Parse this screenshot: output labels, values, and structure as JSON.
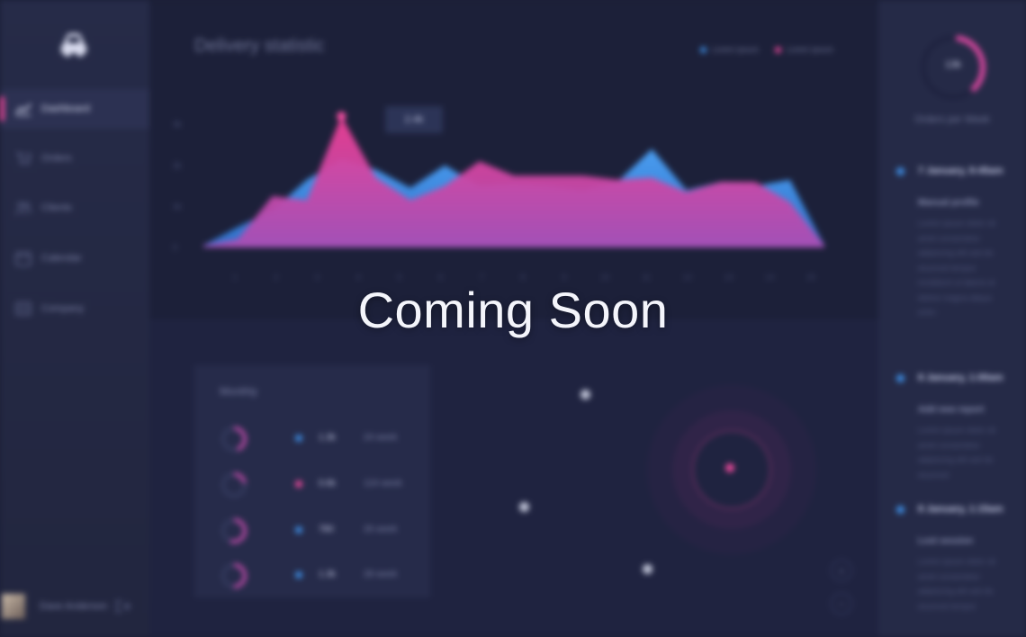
{
  "overlay": {
    "text": "Coming Soon"
  },
  "sidebar": {
    "logo_icon": "car-logo-icon",
    "items": [
      {
        "label": "Dashboard",
        "icon": "chart-icon",
        "active": true
      },
      {
        "label": "Orders",
        "icon": "cart-icon",
        "active": false
      },
      {
        "label": "Clients",
        "icon": "users-icon",
        "active": false
      },
      {
        "label": "Calendar",
        "icon": "calendar-icon",
        "active": false
      },
      {
        "label": "Company",
        "icon": "company-icon",
        "active": false
      }
    ],
    "user": {
      "name": "Dave Anderson",
      "logout_icon": "logout-icon"
    }
  },
  "chart_panel": {
    "title": "Delivery statistic",
    "legend": [
      {
        "label": "Lorem ipsum",
        "color": "#3d8de3"
      },
      {
        "label": "Lorem ipsum",
        "color": "#e9489a"
      }
    ],
    "tooltip": "2.4k"
  },
  "chart_data": {
    "type": "area",
    "title": "Delivery statistic",
    "x": [
      "1",
      "2",
      "3",
      "4",
      "5",
      "6",
      "7",
      "8",
      "9",
      "10",
      "11",
      "12",
      "13",
      "14",
      "15"
    ],
    "y_ticks": [
      "0",
      "1k",
      "2k",
      "3k"
    ],
    "ylim": [
      0,
      3.4
    ],
    "series": [
      {
        "name": "Lorem ipsum",
        "color": "#3d8de3",
        "values": [
          0.05,
          0.5,
          0.9,
          1.65,
          2.15,
          1.9,
          1.45,
          2.0,
          1.5,
          1.55,
          1.5,
          1.4,
          1.6,
          2.4,
          1.4,
          1.6,
          1.5,
          1.65,
          0.05
        ]
      },
      {
        "name": "Lorem ipsum",
        "color": "#e9489a",
        "values": [
          0.05,
          0.2,
          1.25,
          1.15,
          3.2,
          1.7,
          1.15,
          1.5,
          2.1,
          1.75,
          1.75,
          1.75,
          1.65,
          1.7,
          1.35,
          1.6,
          1.6,
          1.1,
          0.05
        ]
      }
    ],
    "grid": false,
    "legend_position": "top-right"
  },
  "monthly": {
    "title": "Monthly",
    "rows": [
      {
        "value": "1.3k",
        "label": "24 week",
        "color": "#3d8de3",
        "fill": 0.45
      },
      {
        "value": "0.6k",
        "label": "124 week",
        "color": "#e9489a",
        "fill": 0.22
      },
      {
        "value": "780",
        "label": "26 week",
        "color": "#3d8de3",
        "fill": 0.55
      },
      {
        "value": "1.3k",
        "label": "28 week",
        "color": "#3d8de3",
        "fill": 0.5
      }
    ]
  },
  "map": {
    "zoom_in": "+",
    "zoom_out": "−",
    "active_marker_color": "#e9489a"
  },
  "right_panel": {
    "gauge": {
      "value": "13k",
      "label": "Orders per Week",
      "fill": 0.35
    },
    "events": [
      {
        "title": "7 January, 9:45am",
        "subtitle": "Manual profile",
        "text": "Lorem ipsum dolor sit amet consectetur adipiscing elit sed do eiusmod tempor incididunt ut labore et dolore magna aliqua enim"
      },
      {
        "title": "8 January, 1:00am",
        "subtitle": "Add new report",
        "text": "Lorem ipsum dolor sit amet consectetur adipiscing elit sed do eiusmod"
      },
      {
        "title": "8 January, 1:15am",
        "subtitle": "Lost session",
        "text": "Lorem ipsum dolor sit amet consectetur adipiscing elit sed do eiusmod tempor"
      }
    ]
  }
}
